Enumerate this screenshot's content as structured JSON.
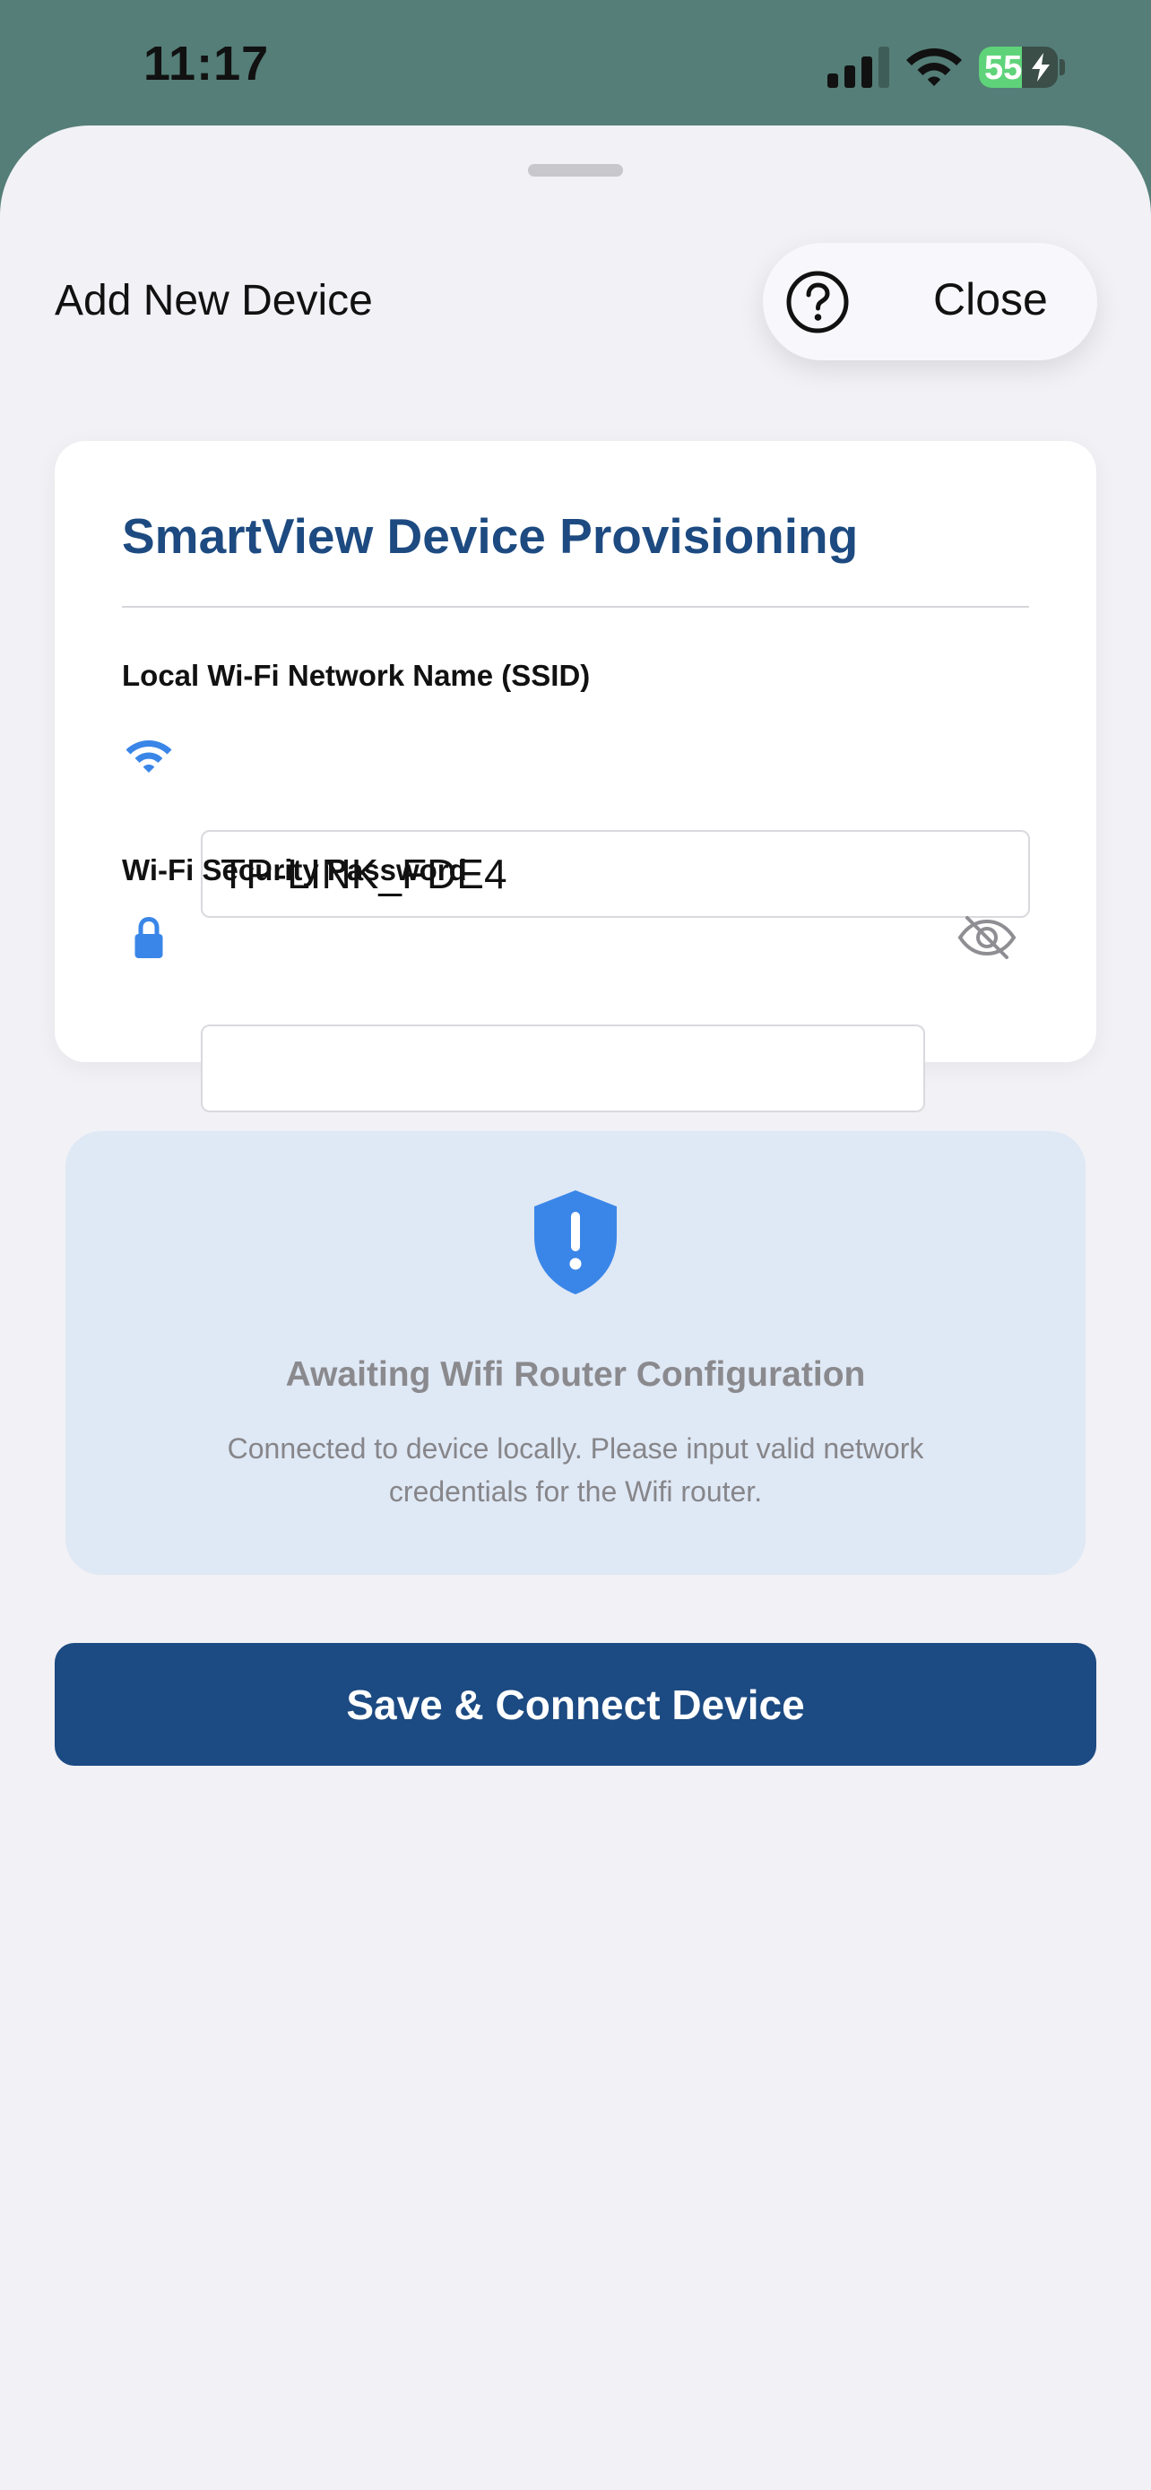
{
  "status_bar": {
    "time": "11:17",
    "battery_percent": "55",
    "battery_level": 0.55,
    "battery_charging": true,
    "signal_bars": 3,
    "icons": [
      "cellular-signal-icon",
      "wifi-icon",
      "battery-charging-icon"
    ]
  },
  "header": {
    "title": "Add New Device",
    "help_icon": "question-circle-icon",
    "close_label": "Close"
  },
  "form": {
    "title": "SmartView Device Provisioning",
    "ssid": {
      "label": "Local Wi-Fi Network Name (SSID)",
      "value": "TP-LINK_FDE4",
      "icon": "wifi-icon"
    },
    "password": {
      "label": "Wi-Fi Security Password",
      "value": "",
      "icon": "lock-icon",
      "toggle_icon": "eye-slash-icon"
    }
  },
  "status_panel": {
    "icon": "shield-exclamation-icon",
    "title": "Awaiting Wifi Router Configuration",
    "message": "Connected to device locally. Please input valid network credentials for the Wifi router."
  },
  "actions": {
    "save_label": "Save & Connect Device"
  },
  "colors": {
    "accent": "#3A86E8",
    "primary_button": "#1C4A82",
    "form_title": "#1D4A80",
    "status_bar_bg": "#547E77",
    "sheet_bg": "#F1F1F6",
    "info_panel_bg": "#DFE8F5",
    "battery_fill": "#5FD37A"
  }
}
